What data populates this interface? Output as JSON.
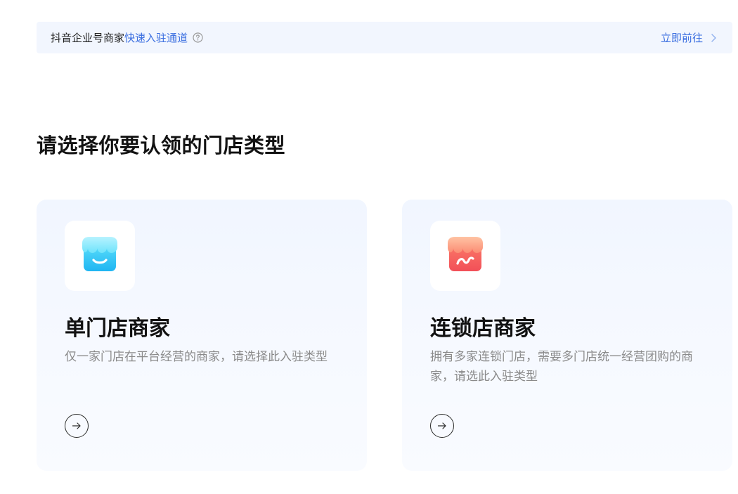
{
  "banner": {
    "prefix": "抖音企业号商家",
    "link_text": "快速入驻通道",
    "action_label": "立即前往",
    "colors": {
      "link": "#3a6ee0",
      "background": "#f2f6fe"
    }
  },
  "main": {
    "title": "请选择你要认领的门店类型",
    "cards": [
      {
        "title": "单门店商家",
        "description": "仅一家门店在平台经营的商家，请选择此入驻类型",
        "icon": "store-icon-blue",
        "accent": "#29c5f6"
      },
      {
        "title": "连锁店商家",
        "description": "拥有多家连锁门店，需要多门店统一经营团购的商家，请选此入驻类型",
        "icon": "store-icon-red",
        "accent": "#f5635e"
      }
    ]
  }
}
